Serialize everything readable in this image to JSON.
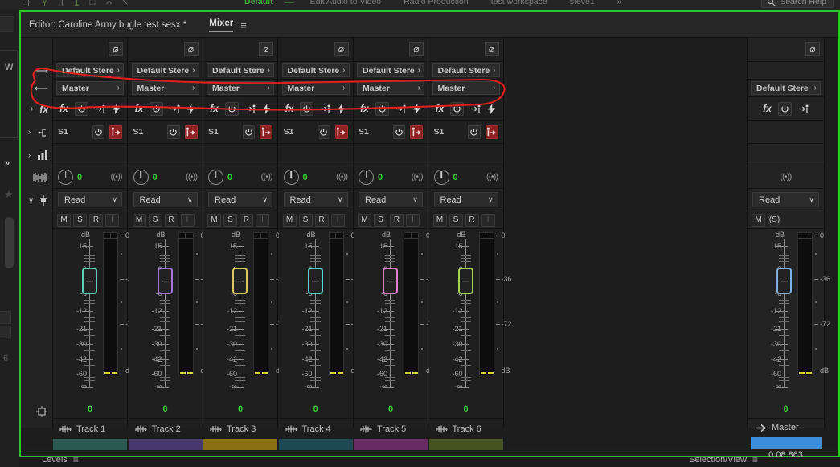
{
  "topbar": {
    "workspaces": [
      {
        "label": "Default",
        "active": true
      },
      {
        "label": "Edit Audio to Video",
        "active": false
      },
      {
        "label": "Radio Production",
        "active": false
      },
      {
        "label": "test workspace",
        "active": false
      },
      {
        "label": "steve1",
        "active": false
      }
    ],
    "overflow_label": "»",
    "search_placeholder": "Search Help",
    "search_icon": "search-icon",
    "accent_green": "#3fae3f"
  },
  "left_browser": {
    "w_label": "W",
    "chevron": "»",
    "star_icon": "favorite-star-icon"
  },
  "panel": {
    "editor_title": "Editor: Caroline Army bugle test.sesx *",
    "mixer_tab": "Mixer",
    "menu_icon": "panel-menu-icon",
    "frame_color": "#2cc82c"
  },
  "gutter": {
    "rows": [
      {
        "icon": "input-arrow-icon",
        "glyph": "→",
        "chevron": ""
      },
      {
        "icon": "output-arrow-icon",
        "glyph": "←",
        "chevron": ""
      },
      {
        "icon": "effects-rack-icon",
        "glyph": "fx",
        "chevron": "›"
      },
      {
        "icon": "sends-icon",
        "glyph": "send",
        "chevron": "›"
      },
      {
        "icon": "eq-icon",
        "glyph": "bars",
        "chevron": "›"
      },
      {
        "icon": "pan-meter-icon",
        "glyph": "wave",
        "chevron": ""
      },
      {
        "icon": "automation-icon",
        "glyph": "fader",
        "chevron": "∨"
      },
      {
        "icon": "track-name-icon",
        "glyph": "io",
        "chevron": ""
      }
    ]
  },
  "rows": {
    "input_label": "Default Stere",
    "output_label": "Master",
    "send_label": "S1",
    "automation_mode": "Read",
    "pan_value": "0",
    "gain_value": "0",
    "mute_label": "M",
    "solo_label": "S",
    "rec_label": "R",
    "input_monitor_label": "I",
    "phase_glyph": "⌀",
    "fx_glyph": "fx",
    "power_glyph": "⏻",
    "prefader_glyph": "→|",
    "bolt_glyph": "⚡",
    "send_glyph": "|→",
    "chevron_right": "›",
    "chevron_down": "∨",
    "output_icon": "((•))"
  },
  "fader_scale": {
    "unit": "dB",
    "ticks": [
      "15",
      "6",
      "0",
      "-6",
      "-12",
      "-21",
      "-30",
      "-42",
      "-60",
      "-∞"
    ]
  },
  "meter_scale": {
    "unit": "dB",
    "ticks": [
      "0",
      "-36",
      "-72"
    ]
  },
  "tracks": [
    {
      "name": "Track 1",
      "color": "#2c5a52",
      "fader_color": "#5fd2b5",
      "gain": "0",
      "pan": "0",
      "input": "Default Stere",
      "output": "Master",
      "send": "S1",
      "automation": "Read"
    },
    {
      "name": "Track 2",
      "color": "#46386c",
      "fader_color": "#a277d8",
      "gain": "0",
      "pan": "0",
      "input": "Default Stere",
      "output": "Master",
      "send": "S1",
      "automation": "Read"
    },
    {
      "name": "Track 3",
      "color": "#8a7012",
      "fader_color": "#d9c85c",
      "gain": "0",
      "pan": "0",
      "input": "Default Stere",
      "output": "Master",
      "send": "S1",
      "automation": "Read"
    },
    {
      "name": "Track 4",
      "color": "#1f4a53",
      "fader_color": "#5ccfd8",
      "gain": "0",
      "pan": "0",
      "input": "Default Stere",
      "output": "Master",
      "send": "S1",
      "automation": "Read"
    },
    {
      "name": "Track 5",
      "color": "#6a2a63",
      "fader_color": "#e07fd0",
      "gain": "0",
      "pan": "0",
      "input": "Default Stere",
      "output": "Master",
      "send": "S1",
      "automation": "Read"
    },
    {
      "name": "Track 6",
      "color": "#44531f",
      "fader_color": "#a8d150",
      "gain": "0",
      "pan": "0",
      "input": "Default Stere",
      "output": "Master",
      "send": "S1",
      "automation": "Read"
    }
  ],
  "master": {
    "name": "Master",
    "input": "Default Stere",
    "automation": "Read",
    "mute_label": "M",
    "solo_label": "S",
    "gain": "0",
    "timecode": "0:08.863",
    "color": "#3d8fdc",
    "fader_color": "#7fb2dd",
    "phase_glyph": "⌀",
    "output_icon": "((•))"
  },
  "bottom_panels": [
    {
      "label": "Levels",
      "menu_icon": "panel-menu-icon"
    },
    {
      "label": "Selection/View",
      "menu_icon": "panel-menu-icon"
    }
  ],
  "annotation": {
    "type": "hand-drawn-oval",
    "color": "#e02020",
    "target": "Master output row across all tracks"
  }
}
